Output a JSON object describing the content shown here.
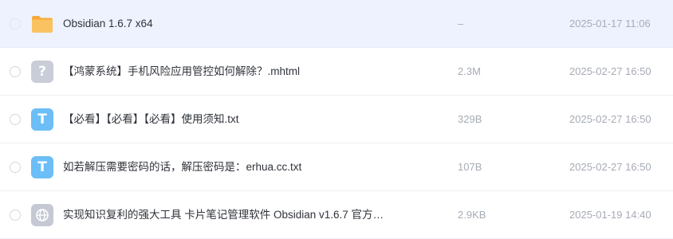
{
  "files": [
    {
      "name": "Obsidian 1.6.7 x64",
      "size": "–",
      "date": "2025-01-17 11:06",
      "icon": "folder-icon",
      "selected": true
    },
    {
      "name": "【鸿蒙系统】手机风险应用管控如何解除？.mhtml",
      "size": "2.3M",
      "date": "2025-02-27 16:50",
      "icon": "unknown-file-icon",
      "icon_glyph": "?"
    },
    {
      "name": "【必看】【必看】【必看】使用须知.txt",
      "size": "329B",
      "date": "2025-02-27 16:50",
      "icon": "text-file-icon",
      "icon_glyph": "T"
    },
    {
      "name": "如若解压需要密码的话，解压密码是：erhua.cc.txt",
      "size": "107B",
      "date": "2025-02-27 16:50",
      "icon": "text-file-icon",
      "icon_glyph": "T"
    },
    {
      "name": "实现知识复利的强大工具 卡片笔记管理软件 Obsidian v1.6.7 官方免…",
      "size": "2.9KB",
      "date": "2025-01-19 14:40",
      "icon": "web-link-icon"
    }
  ],
  "colors": {
    "selected_row_bg": "#eef2fe",
    "text_icon_bg": "#6cbef6",
    "folder_color": "#f8b84e",
    "muted_text": "#a6abb5"
  }
}
